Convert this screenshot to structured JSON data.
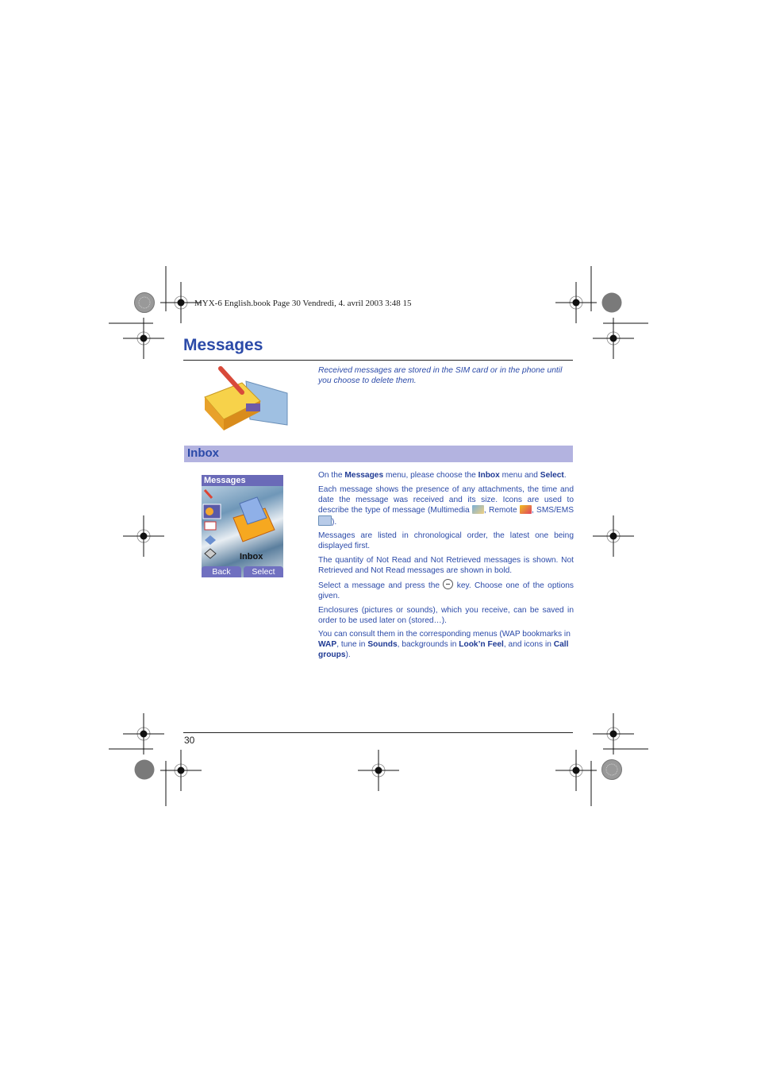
{
  "print_header": "MYX-6 English.book  Page 30  Vendredi, 4. avril 2003  3:48 15",
  "page": {
    "title": "Messages",
    "intro": "Received messages are stored in the SIM card or in the phone until you choose to delete them.",
    "page_number": "30"
  },
  "section": {
    "title": "Inbox",
    "paragraphs": {
      "p1": {
        "a": "On the ",
        "b1": "Messages",
        "c": " menu, please choose the ",
        "b2": "Inbox",
        "d": " menu and ",
        "b3": "Select",
        "e": "."
      },
      "p2": {
        "a": "Each message shows the presence of any attachments, the time and date the message was received and its size. Icons are used to describe the type of message (Multimedia ",
        "b": ", Remote ",
        "c": ", SMS/EMS ",
        "d": ")."
      },
      "p3": "Messages are listed in chronological order, the latest one being displayed first.",
      "p4": "The quantity of Not Read and Not Retrieved messages is shown. Not Retrieved and Not Read messages are shown in bold.",
      "p5": {
        "a": "Select a message and press the ",
        "b": " key. Choose one of the options given."
      },
      "p6": "Enclosures (pictures or sounds), which you receive, can be saved in order to be used later on (stored…).",
      "p7": {
        "a": "You can consult them in the corresponding menus (WAP bookmarks in ",
        "b1": "WAP",
        "c": ", tune in ",
        "b2": "Sounds",
        "d": ", backgrounds in ",
        "b3": "Look’n Feel",
        "e": ", and icons in ",
        "b4": "Call groups",
        "f": ")."
      }
    }
  },
  "phone_screen": {
    "header": "Messages",
    "selected_item": "Inbox",
    "softkey_left": "Back",
    "softkey_right": "Select"
  },
  "icons": {
    "illustration": "notepad-pencil-icon",
    "multimedia": "multimedia-message-icon",
    "remote": "remote-message-icon",
    "sms": "sms-envelope-icon",
    "key": "ok-key-icon"
  },
  "colors": {
    "accent": "#2b4aa8",
    "section_bar": "#b3b3e0",
    "phone_bar": "#6a6ab8"
  }
}
